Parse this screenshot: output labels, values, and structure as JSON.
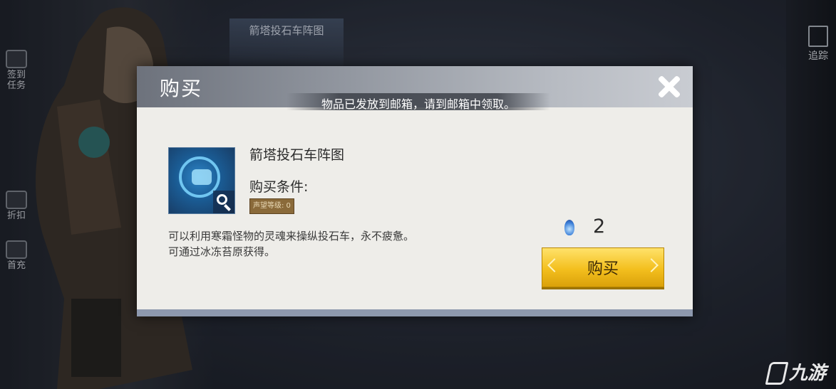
{
  "background": {
    "banner_title": "箭塔投石车阵图",
    "left_menu": [
      "签到\n任务",
      "折扣",
      "首充"
    ],
    "right_menu": "追踪"
  },
  "dialog": {
    "title": "购买",
    "notice": "物品已发放到邮箱，请到邮箱中领取。",
    "item": {
      "name": "箭塔投石车阵图",
      "condition_label": "购买条件:",
      "condition_badge": "声望等级: 0",
      "description_line1": "可以利用寒霜怪物的灵魂来操纵投石车，永不疲惫。",
      "description_line2": "可通过冰冻苔原获得。",
      "icon": "arrow-tower-catapult-blueprint-icon"
    },
    "price": {
      "currency_icon": "soul-flame-gem-icon",
      "amount": "2"
    },
    "buy_button_label": "购买"
  },
  "watermark": "九游",
  "colors": {
    "dialog_bg": "#eeede9",
    "header_gradient_start": "#6d727c",
    "buy_button": "#f3bf1e",
    "dialog_bottom_bar": "#8e99ae"
  }
}
